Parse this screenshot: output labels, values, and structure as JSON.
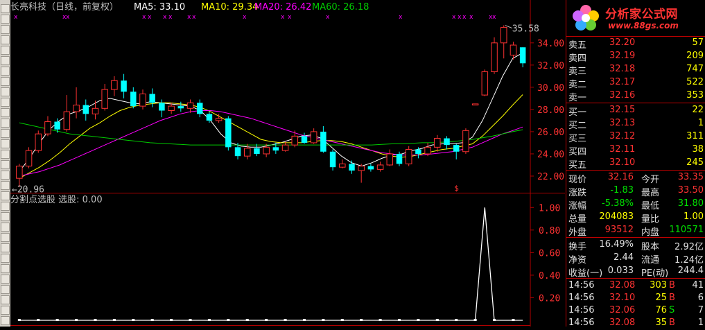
{
  "header": {
    "stock_title": "长亮科技（日线，前复权）",
    "ma5_label": "MA5: 33.10",
    "ma10_label": "MA10: 29.34",
    "ma20_label": "MA20: 26.42",
    "ma60_label": "MA60: 26.18"
  },
  "main_chart": {
    "y_ticks": [
      "34.00",
      "32.00",
      "30.00",
      "28.00",
      "26.00",
      "24.00",
      "22.00"
    ],
    "ylim": [
      20.5,
      36.8
    ],
    "high_marker": "35.58",
    "low_marker": "←20.96",
    "signal_mark": "$",
    "colors": {
      "up": "#ff3232",
      "down": "#00ffff",
      "ma5": "#ffffff",
      "ma10": "#ffff00",
      "ma20": "#ff00ff",
      "ma60": "#00cc00",
      "grid": "#b00000"
    }
  },
  "chart_data": [
    {
      "type": "candlestick",
      "title": "长亮科技（日线，前复权）",
      "series": [
        {
          "name": "MA5",
          "values": [
            22.4,
            23.6,
            25.0,
            26.2,
            27.0,
            27.6,
            27.9,
            28.3,
            28.8,
            29.0,
            28.8,
            28.6,
            28.5,
            28.7,
            28.6,
            28.5,
            28.4,
            28.3,
            27.9,
            27.0,
            25.8,
            25.0,
            24.7,
            24.6,
            24.6,
            24.8,
            25.0,
            25.3,
            25.6,
            25.7,
            25.4,
            24.6,
            23.8,
            23.2,
            22.9,
            23.2,
            23.6,
            23.9,
            24.0,
            24.3,
            24.5,
            24.8,
            24.9,
            24.9,
            25.0,
            25.5,
            27.0,
            29.0,
            31.0,
            32.6,
            33.1
          ]
        },
        {
          "name": "MA10",
          "values": [
            21.8,
            22.3,
            22.8,
            23.4,
            24.1,
            24.9,
            25.6,
            26.3,
            26.8,
            27.4,
            27.9,
            28.2,
            28.4,
            28.5,
            28.6,
            28.6,
            28.5,
            28.4,
            28.2,
            27.8,
            27.3,
            26.8,
            26.3,
            25.8,
            25.3,
            25.1,
            25.0,
            25.0,
            25.0,
            25.1,
            25.2,
            25.2,
            25.1,
            24.9,
            24.6,
            24.3,
            24.0,
            23.8,
            23.7,
            23.8,
            24.0,
            24.2,
            24.4,
            24.5,
            24.7,
            24.9,
            25.6,
            26.5,
            27.4,
            28.4,
            29.34
          ]
        },
        {
          "name": "MA20",
          "values": [
            22.0,
            22.2,
            22.4,
            22.7,
            23.0,
            23.4,
            23.8,
            24.2,
            24.6,
            25.0,
            25.4,
            25.8,
            26.2,
            26.6,
            27.0,
            27.3,
            27.6,
            27.8,
            27.9,
            27.9,
            27.8,
            27.6,
            27.4,
            27.2,
            26.9,
            26.6,
            26.3,
            26.0,
            25.7,
            25.5,
            25.3,
            25.1,
            24.9,
            24.7,
            24.5,
            24.3,
            24.1,
            24.0,
            23.9,
            23.9,
            23.9,
            24.0,
            24.1,
            24.2,
            24.4,
            24.6,
            25.0,
            25.4,
            25.8,
            26.1,
            26.42
          ]
        },
        {
          "name": "MA60",
          "values": [
            26.8,
            26.6,
            26.4,
            26.2,
            26.0,
            25.8,
            25.7,
            25.6,
            25.5,
            25.4,
            25.3,
            25.2,
            25.1,
            25.0,
            24.95,
            24.9,
            24.85,
            24.8,
            24.8,
            24.8,
            24.8,
            24.8,
            24.8,
            24.8,
            24.8,
            24.8,
            24.8,
            24.8,
            24.8,
            24.8,
            24.8,
            24.8,
            24.8,
            24.8,
            24.8,
            24.8,
            24.85,
            24.9,
            24.9,
            24.95,
            25.0,
            25.0,
            25.05,
            25.1,
            25.2,
            25.3,
            25.45,
            25.6,
            25.8,
            26.0,
            26.18
          ]
        }
      ],
      "candles": [
        [
          21.8,
          22.9,
          23.1,
          21.0
        ],
        [
          22.9,
          24.3,
          24.6,
          22.7
        ],
        [
          24.3,
          25.8,
          26.1,
          24.1
        ],
        [
          25.8,
          26.9,
          27.4,
          25.6
        ],
        [
          26.9,
          26.2,
          27.2,
          25.9
        ],
        [
          26.2,
          27.8,
          29.3,
          26.0
        ],
        [
          27.8,
          28.4,
          30.0,
          27.2
        ],
        [
          28.4,
          27.6,
          28.9,
          27.0
        ],
        [
          27.6,
          28.1,
          28.8,
          27.1
        ],
        [
          28.1,
          29.8,
          30.3,
          27.9
        ],
        [
          29.8,
          30.6,
          31.0,
          29.2
        ],
        [
          30.6,
          29.6,
          31.2,
          29.0
        ],
        [
          29.6,
          28.3,
          30.0,
          28.1
        ],
        [
          28.3,
          29.4,
          29.8,
          28.0
        ],
        [
          29.4,
          28.6,
          29.9,
          28.2
        ],
        [
          28.6,
          27.9,
          28.9,
          27.3
        ],
        [
          27.9,
          28.3,
          28.6,
          27.6
        ],
        [
          28.3,
          28.1,
          28.7,
          27.8
        ],
        [
          28.1,
          28.6,
          28.9,
          27.7
        ],
        [
          28.6,
          27.6,
          28.9,
          27.3
        ],
        [
          27.6,
          27.0,
          27.8,
          26.8
        ],
        [
          27.0,
          27.2,
          27.6,
          26.8
        ],
        [
          27.2,
          24.6,
          27.4,
          24.3
        ],
        [
          24.6,
          23.8,
          25.0,
          23.5
        ],
        [
          23.8,
          24.5,
          24.9,
          23.5
        ],
        [
          24.5,
          24.0,
          24.9,
          23.8
        ],
        [
          24.0,
          24.6,
          24.9,
          23.7
        ],
        [
          24.6,
          24.3,
          25.0,
          24.0
        ],
        [
          24.3,
          24.8,
          25.1,
          24.2
        ],
        [
          24.8,
          25.6,
          26.1,
          24.6
        ],
        [
          25.6,
          25.0,
          25.9,
          24.9
        ],
        [
          25.0,
          26.0,
          26.3,
          24.9
        ],
        [
          26.0,
          24.2,
          26.5,
          24.1
        ],
        [
          24.2,
          22.8,
          24.4,
          22.5
        ],
        [
          22.8,
          23.1,
          23.5,
          22.7
        ],
        [
          23.1,
          22.5,
          23.4,
          22.2
        ],
        [
          22.5,
          22.9,
          23.1,
          21.4
        ],
        [
          22.9,
          22.6,
          23.1,
          22.4
        ],
        [
          22.6,
          23.0,
          23.3,
          22.4
        ],
        [
          23.0,
          24.0,
          24.4,
          22.9
        ],
        [
          24.0,
          23.1,
          24.2,
          22.9
        ],
        [
          23.1,
          24.4,
          24.7,
          22.9
        ],
        [
          24.4,
          24.0,
          24.6,
          23.6
        ],
        [
          24.0,
          24.6,
          25.0,
          23.8
        ],
        [
          24.6,
          25.4,
          25.7,
          24.2
        ],
        [
          25.4,
          24.8,
          25.6,
          24.4
        ],
        [
          24.8,
          24.2,
          24.9,
          23.5
        ],
        [
          24.2,
          26.1,
          26.3,
          24.0
        ],
        [
          28.4,
          28.5,
          28.5,
          28.4
        ],
        [
          29.3,
          31.4,
          31.6,
          29.2
        ],
        [
          31.4,
          34.0,
          34.5,
          31.2
        ],
        [
          34.0,
          35.4,
          35.58,
          32.6
        ],
        [
          32.9,
          33.8,
          34.1,
          32.5
        ],
        [
          33.6,
          32.16,
          33.6,
          31.8
        ]
      ],
      "ylim": [
        20.5,
        36.8
      ]
    },
    {
      "type": "line",
      "title": "分割点选股 选股: 0.00",
      "y_ticks": [
        "1.00",
        "0.80",
        "0.60",
        "0.40",
        "0.20"
      ],
      "ylim": [
        0,
        1.1
      ],
      "series": [
        {
          "name": "选股",
          "values": [
            0,
            0,
            0,
            0,
            0,
            0,
            0,
            0,
            0,
            0,
            0,
            0,
            0,
            0,
            0,
            0,
            0,
            0,
            0,
            0,
            0,
            0,
            0,
            0,
            0,
            0,
            0,
            0,
            0,
            0,
            0,
            0,
            0,
            0,
            0,
            0,
            0,
            0,
            0,
            0,
            0,
            0,
            0,
            0,
            0,
            0,
            0,
            0,
            0,
            1,
            0,
            0,
            0,
            0
          ]
        }
      ]
    }
  ],
  "indicator": {
    "title": "分割点选股 选股: 0.00"
  },
  "quote_panel": {
    "logo_title": "分析家公式网",
    "logo_url": "www.88gs.com",
    "asks": [
      {
        "label": "卖五",
        "price": "32.20",
        "vol": "57"
      },
      {
        "label": "卖四",
        "price": "32.19",
        "vol": "209"
      },
      {
        "label": "卖三",
        "price": "32.18",
        "vol": "747"
      },
      {
        "label": "卖二",
        "price": "32.17",
        "vol": "522"
      },
      {
        "label": "卖一",
        "price": "32.16",
        "vol": "353"
      }
    ],
    "bids": [
      {
        "label": "买一",
        "price": "32.15",
        "vol": "22"
      },
      {
        "label": "买二",
        "price": "32.13",
        "vol": "1"
      },
      {
        "label": "买三",
        "price": "32.12",
        "vol": "311"
      },
      {
        "label": "买四",
        "price": "32.11",
        "vol": "38"
      },
      {
        "label": "买五",
        "price": "32.10",
        "vol": "245"
      }
    ],
    "stats": [
      {
        "l1": "现价",
        "v1": "32.16",
        "l2": "今开",
        "v2": "33.35"
      },
      {
        "l1": "涨跌",
        "v1": "-1.83",
        "l2": "最高",
        "v2": "33.50"
      },
      {
        "l1": "涨幅",
        "v1": "-5.38%",
        "l2": "最低",
        "v2": "31.80"
      },
      {
        "l1": "总量",
        "v1": "204083",
        "l2": "量比",
        "v2": "1.00"
      },
      {
        "l1": "外盘",
        "v1": "93512",
        "l2": "内盘",
        "v2": "110571"
      }
    ],
    "fund": [
      {
        "l1": "换手",
        "v1": "16.49%",
        "l2": "股本",
        "v2": "2.92亿"
      },
      {
        "l1": "净资",
        "v1": "2.44",
        "l2": "流通",
        "v2": "1.24亿"
      },
      {
        "l1": "收益(一)",
        "v1": "0.033",
        "l2": "PE(动)",
        "v2": "244.4"
      }
    ],
    "ticks": [
      {
        "time": "14:56",
        "price": "32.08",
        "vol": "303",
        "bs": "B",
        "n": "41"
      },
      {
        "time": "14:56",
        "price": "32.10",
        "vol": "25",
        "bs": "B",
        "n": "6"
      },
      {
        "time": "14:56",
        "price": "32.06",
        "vol": "76",
        "bs": "S",
        "n": "7"
      },
      {
        "time": "14:56",
        "price": "32.08",
        "vol": "35",
        "bs": "B",
        "n": "1"
      }
    ]
  }
}
